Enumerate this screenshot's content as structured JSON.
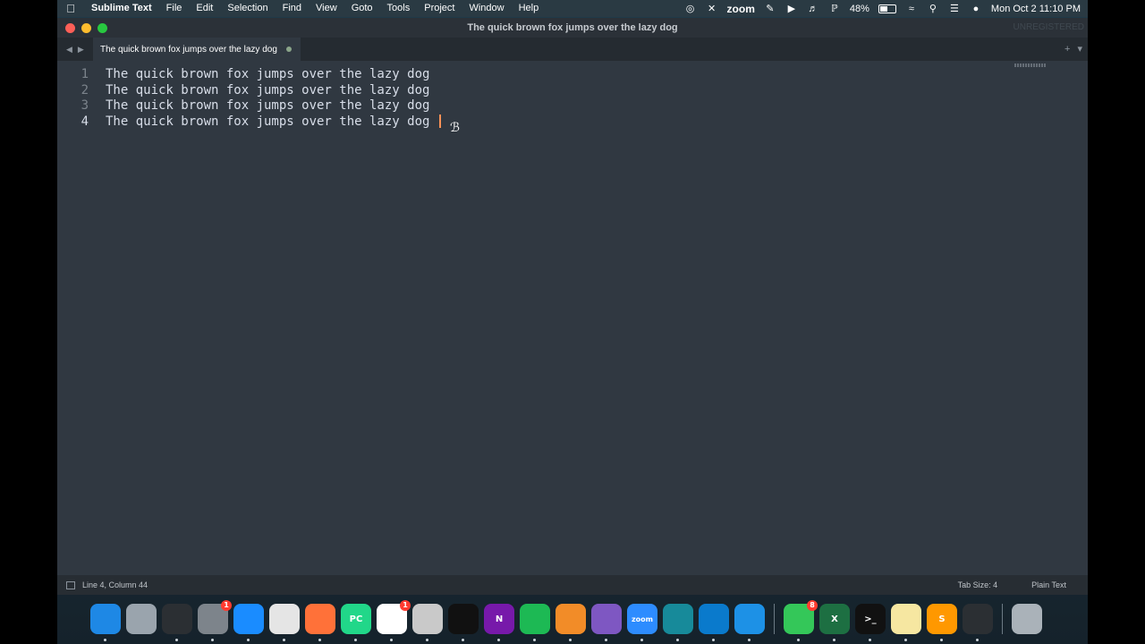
{
  "menubar": {
    "app_name": "Sublime Text",
    "menus": [
      "File",
      "Edit",
      "Selection",
      "Find",
      "View",
      "Goto",
      "Tools",
      "Project",
      "Window",
      "Help"
    ],
    "zoom_label": "zoom",
    "battery_percent": "48%",
    "battery_level": 0.48,
    "datetime": "Mon Oct 2  11:10 PM"
  },
  "window": {
    "title": "The quick brown fox jumps over the lazy dog",
    "unregistered": "UNREGISTERED"
  },
  "tab": {
    "label": "The quick brown fox jumps over the lazy dog"
  },
  "editor": {
    "lines": [
      {
        "num": "1",
        "text": "The quick brown fox jumps over the lazy dog"
      },
      {
        "num": "2",
        "text": "The quick brown fox jumps over the lazy dog"
      },
      {
        "num": "3",
        "text": "The quick brown fox jumps over the lazy dog"
      },
      {
        "num": "4",
        "text": "The quick brown fox jumps over the lazy dog"
      }
    ],
    "current_line": 4
  },
  "statusbar": {
    "position": "Line 4, Column 44",
    "tab_size": "Tab Size: 4",
    "syntax": "Plain Text"
  },
  "dock": {
    "items": [
      {
        "name": "finder",
        "label": "",
        "color": "#1e88e5",
        "badge": ""
      },
      {
        "name": "launchpad",
        "label": "",
        "color": "#9aa4ad",
        "badge": ""
      },
      {
        "name": "activity-monitor",
        "label": "",
        "color": "#2b2f33",
        "badge": ""
      },
      {
        "name": "system-settings",
        "label": "",
        "color": "#7d848b",
        "badge": "1"
      },
      {
        "name": "app-store",
        "label": "",
        "color": "#1a8cff",
        "badge": ""
      },
      {
        "name": "chrome",
        "label": "",
        "color": "#e5e5e5",
        "badge": ""
      },
      {
        "name": "firefox",
        "label": "",
        "color": "#ff7139",
        "badge": ""
      },
      {
        "name": "pycharm",
        "label": "PC",
        "color": "#21d789",
        "badge": ""
      },
      {
        "name": "slack",
        "label": "",
        "color": "#ffffff",
        "badge": "1"
      },
      {
        "name": "finder-alt",
        "label": "",
        "color": "#c9c9c9",
        "badge": ""
      },
      {
        "name": "terminal-alt",
        "label": "",
        "color": "#111111",
        "badge": ""
      },
      {
        "name": "onenote",
        "label": "N",
        "color": "#7719aa",
        "badge": ""
      },
      {
        "name": "spotify",
        "label": "",
        "color": "#1db954",
        "badge": ""
      },
      {
        "name": "vpn",
        "label": "",
        "color": "#f28c28",
        "badge": ""
      },
      {
        "name": "github-desktop",
        "label": "",
        "color": "#7e57c2",
        "badge": ""
      },
      {
        "name": "zoom",
        "label": "zoom",
        "color": "#2d8cff",
        "badge": ""
      },
      {
        "name": "surfshark",
        "label": "",
        "color": "#178a9a",
        "badge": ""
      },
      {
        "name": "vscode",
        "label": "",
        "color": "#0a7acc",
        "badge": ""
      },
      {
        "name": "docker",
        "label": "",
        "color": "#1d91e6",
        "badge": ""
      },
      {
        "name": "messages",
        "label": "",
        "color": "#34c759",
        "badge": "8"
      },
      {
        "name": "excel",
        "label": "X",
        "color": "#1d6f42",
        "badge": ""
      },
      {
        "name": "terminal",
        "label": ">_",
        "color": "#111111",
        "badge": ""
      },
      {
        "name": "notes",
        "label": "",
        "color": "#f6e7a1",
        "badge": ""
      },
      {
        "name": "sublime-text",
        "label": "S",
        "color": "#ff9800",
        "badge": ""
      },
      {
        "name": "screen-recorder",
        "label": "",
        "color": "#2b2f33",
        "badge": ""
      },
      {
        "name": "trash",
        "label": "",
        "color": "#aab2b9",
        "badge": ""
      }
    ]
  }
}
